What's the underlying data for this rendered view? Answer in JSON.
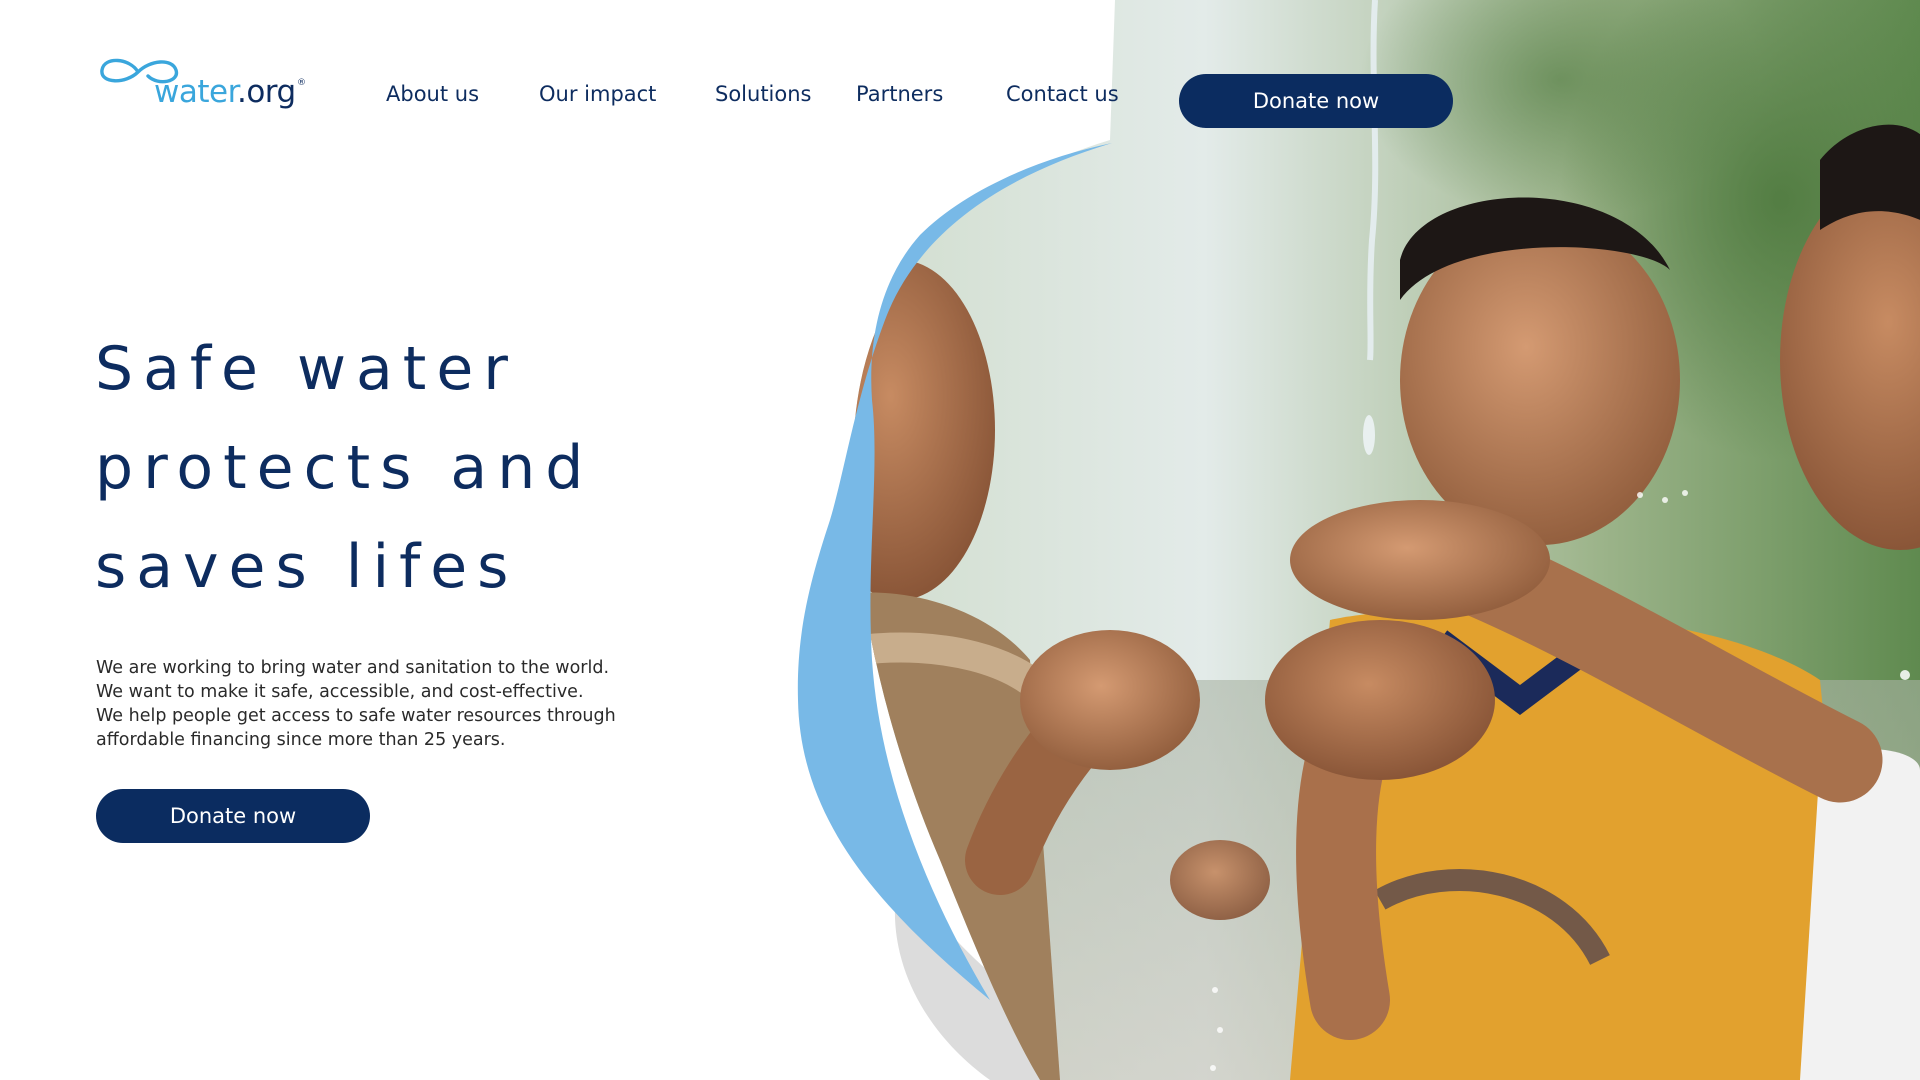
{
  "header": {
    "logo": {
      "text_main": "water",
      "text_suffix": ".org",
      "registered": "®",
      "icon": "infinity-drop-icon"
    },
    "nav": [
      {
        "label": "About us"
      },
      {
        "label": "Our impact"
      },
      {
        "label": "Solutions"
      },
      {
        "label": "Partners"
      },
      {
        "label": "Contact us"
      }
    ],
    "donate_label": "Donate now"
  },
  "hero": {
    "title_lines": [
      "Safe water",
      "protects and",
      "saves lifes"
    ],
    "description_lines": [
      "We are working to bring water and sanitation to the world.",
      "We want to make it safe, accessible, and cost-effective.",
      "We help people get access to safe water resources through",
      "affordable financing since more than 25 years."
    ],
    "cta_label": "Donate now",
    "image": "children-catching-water-photo"
  },
  "colors": {
    "navy": "#0b2c60",
    "logo_blue": "#3aa6dc",
    "accent_blue": "#78b9e7",
    "swoosh_gray": "#dcdcdc",
    "text_dark": "#2a2a2a"
  }
}
